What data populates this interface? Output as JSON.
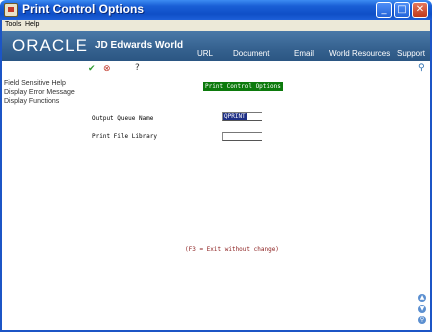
{
  "window": {
    "title": "Print Control Options",
    "controls": {
      "minimize": "_",
      "maximize": "□",
      "close": "✕"
    }
  },
  "menubar": {
    "items": [
      "Tools",
      "Help"
    ]
  },
  "banner": {
    "logo": "ORACLE",
    "product": "JD Edwards World",
    "nav": [
      "URL",
      "Document",
      "Email",
      "World Resources",
      "Support"
    ]
  },
  "toolbar": {
    "ok_icon": "check-icon",
    "cancel_icon": "cancel-icon",
    "help_label": "?",
    "search_icon": "search-icon"
  },
  "leftpanel": {
    "links": [
      "Field Sensitive Help",
      "Display Error Message",
      "Display Functions"
    ]
  },
  "form": {
    "screen_title": "Print Control Options",
    "fields": [
      {
        "label": "Output Queue Name",
        "value": "QPRINT"
      },
      {
        "label": "Print File Library",
        "value": ""
      }
    ],
    "exit_message": "(F3 = Exit without change)"
  },
  "colors": {
    "title_bar": "#1a5fd6",
    "banner": "#35618f",
    "screen_title_bg": "#0c7a0c",
    "exit_message": "#8a1c1c",
    "input_highlight": "#1e2f86"
  }
}
